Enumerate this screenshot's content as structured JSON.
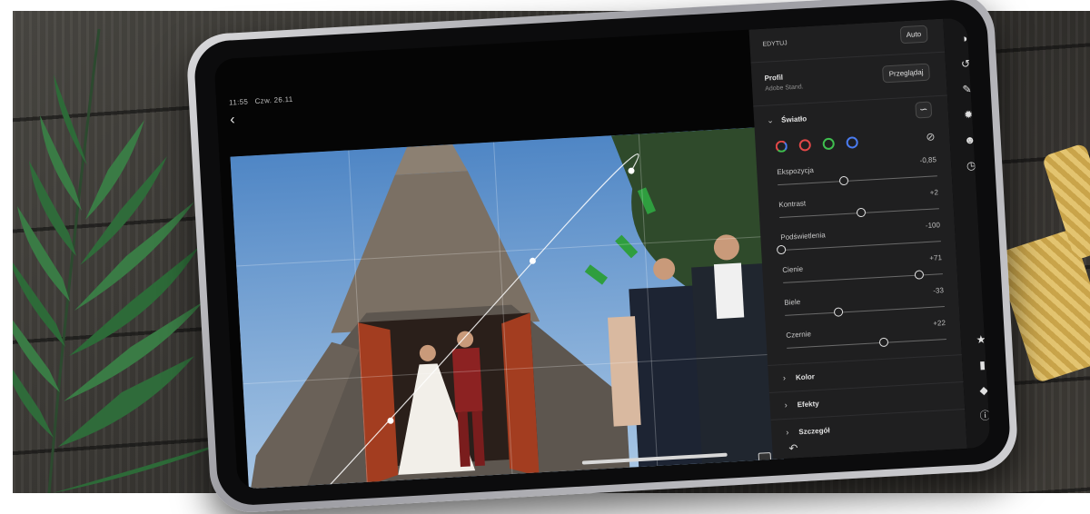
{
  "status_bar": {
    "time": "11:55",
    "date": "Czw. 26.11"
  },
  "photo_tools": {
    "back_icon": "chevron-left-icon",
    "compare_icon": "photo-compare-icon"
  },
  "panel": {
    "edit": {
      "label": "Edytuj",
      "auto_label": "Auto"
    },
    "profile": {
      "title": "Profil",
      "name": "Adobe Stand.",
      "browse_label": "Przeglądaj"
    },
    "light": {
      "title": "Światło",
      "curve_icon": "tone-curve-icon",
      "channel_icons": [
        "rgb-channel-icon",
        "red-channel-icon",
        "green-channel-icon",
        "blue-channel-icon"
      ],
      "channel_colors": [
        "#e34848",
        "#3fbf4f",
        "#4a7bf0"
      ],
      "reset_icon": "no-visibility-icon",
      "sliders": [
        {
          "label": "Ekspozycja",
          "value": "-0,85",
          "numeric": -0.85,
          "min": -5,
          "max": 5
        },
        {
          "label": "Kontrast",
          "value": "+2",
          "numeric": 2,
          "min": -100,
          "max": 100
        },
        {
          "label": "Podświetlenia",
          "value": "-100",
          "numeric": -100,
          "min": -100,
          "max": 100
        },
        {
          "label": "Cienie",
          "value": "+71",
          "numeric": 71,
          "min": -100,
          "max": 100
        },
        {
          "label": "Biele",
          "value": "-33",
          "numeric": -33,
          "min": -100,
          "max": 100
        },
        {
          "label": "Czernie",
          "value": "+22",
          "numeric": 22,
          "min": -100,
          "max": 100
        }
      ]
    },
    "sections": [
      {
        "label": "Kolor"
      },
      {
        "label": "Efekty"
      },
      {
        "label": "Szczegół"
      }
    ],
    "undo_icon": "undo-icon"
  },
  "toolstrip": {
    "icons": [
      "presets-icon",
      "crop-icon",
      "brush-icon",
      "radial-icon",
      "healing-icon",
      "history-icon",
      "star-icon",
      "comment-icon",
      "tag-icon",
      "info-icon"
    ]
  }
}
